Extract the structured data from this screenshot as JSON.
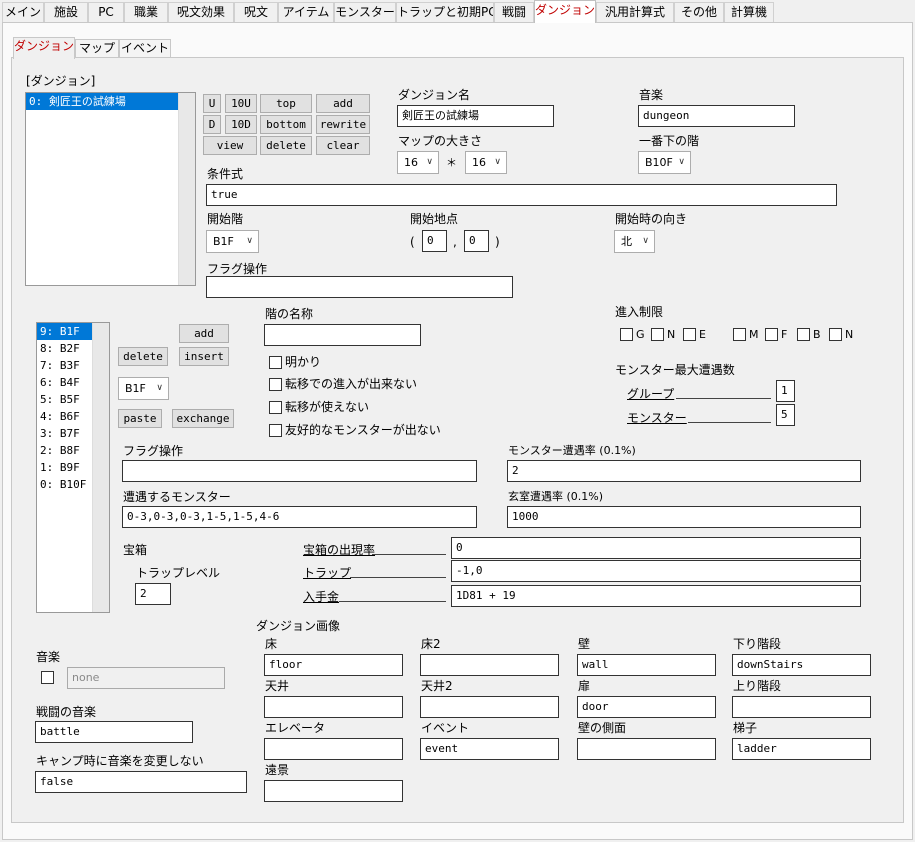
{
  "top_tabs": [
    "メイン",
    "施設",
    "PC",
    "職業",
    "呪文効果",
    "呪文",
    "アイテム",
    "モンスター",
    "トラップと初期PC",
    "戦闘",
    "ダンジョン",
    "汎用計算式",
    "その他",
    "計算機"
  ],
  "sub_tabs": [
    "ダンジョン",
    "マップ",
    "イベント"
  ],
  "dungeon": {
    "list_label": "[ダンジョン]",
    "list_items": [
      "0: 剣匠王の試練場"
    ],
    "buttons": {
      "u": "U",
      "u10": "10U",
      "top": "top",
      "add": "add",
      "d": "D",
      "d10": "10D",
      "bottom": "bottom",
      "rewrite": "rewrite",
      "view": "view",
      "delete": "delete",
      "clear": "clear"
    },
    "name_label": "ダンジョン名",
    "name_value": "剣匠王の試練場",
    "music_label": "音楽",
    "music_value": "dungeon",
    "mapsize_label": "マップの大きさ",
    "map_w": "16",
    "times": "＊",
    "map_h": "16",
    "bottom_floor_label": "一番下の階",
    "bottom_floor_value": "B10F",
    "condition_label": "条件式",
    "condition_value": "true",
    "start_floor_label": "開始階",
    "start_floor_value": "B1F",
    "start_point_label": "開始地点",
    "paren_open": "(",
    "start_x": "0",
    "comma": ",",
    "start_y": "0",
    "paren_close": ")",
    "start_dir_label": "開始時の向き",
    "start_dir_value": "北",
    "flag_label": "フラグ操作",
    "flag_value": ""
  },
  "floor": {
    "items": [
      "9:  B1F",
      "8:  B2F",
      "7:  B3F",
      "6:  B4F",
      "5:  B5F",
      "4:  B6F",
      "3:  B7F",
      "2:  B8F",
      "1:  B9F",
      "0: B10F"
    ],
    "add": "add",
    "delete": "delete",
    "insert": "insert",
    "select_value": "B1F",
    "paste": "paste",
    "exchange": "exchange",
    "name_label": "階の名称",
    "name_value": "",
    "checks": [
      "明かり",
      "転移での進入が出来ない",
      "転移が使えない",
      "友好的なモンスターが出ない"
    ],
    "entry_label": "進入制限",
    "entry_opts": [
      "G",
      "N",
      "E",
      "M",
      "F",
      "B",
      "N"
    ],
    "max_enc_label": "モンスター最大遭遇数",
    "group_label": "グループ",
    "group_value": "1",
    "monster_label": "モンスター",
    "monster_value": "5",
    "flag_label": "フラグ操作",
    "flag_value": "",
    "enc_rate_label": "モンスター遭遇率 (0.1%)",
    "enc_rate_value": "2",
    "monsters_label": "遭遇するモンスター",
    "monsters_value": "0-3,0-3,0-3,1-5,1-5,4-6",
    "room_rate_label": "玄室遭遇率 (0.1%)",
    "room_rate_value": "1000",
    "chest_label": "宝箱",
    "chest_rate_label": "宝箱の出現率",
    "chest_rate_value": "0",
    "trap_level_label": "トラップレベル",
    "trap_level_value": "2",
    "trap_label": "トラップ",
    "trap_value": "-1,0",
    "gold_label": "入手金",
    "gold_value": "1D81 + 19"
  },
  "bottom": {
    "music_label": "音楽",
    "music_placeholder": "none",
    "battle_music_label": "戦闘の音楽",
    "battle_music_value": "battle",
    "camp_label": "キャンプ時に音楽を変更しない",
    "camp_value": "false",
    "images_label": "ダンジョン画像",
    "images": [
      {
        "label": "床",
        "value": "floor"
      },
      {
        "label": "床2",
        "value": ""
      },
      {
        "label": "壁",
        "value": "wall"
      },
      {
        "label": "下り階段",
        "value": "downStairs"
      },
      {
        "label": "天井",
        "value": ""
      },
      {
        "label": "天井2",
        "value": ""
      },
      {
        "label": "扉",
        "value": "door"
      },
      {
        "label": "上り階段",
        "value": ""
      },
      {
        "label": "エレベータ",
        "value": ""
      },
      {
        "label": "イベント",
        "value": "event"
      },
      {
        "label": "壁の側面",
        "value": ""
      },
      {
        "label": "梯子",
        "value": "ladder"
      },
      {
        "label": "遠景",
        "value": ""
      }
    ]
  },
  "colors": {
    "active_tab_text": "#c00000",
    "selection": "#0078d7"
  }
}
